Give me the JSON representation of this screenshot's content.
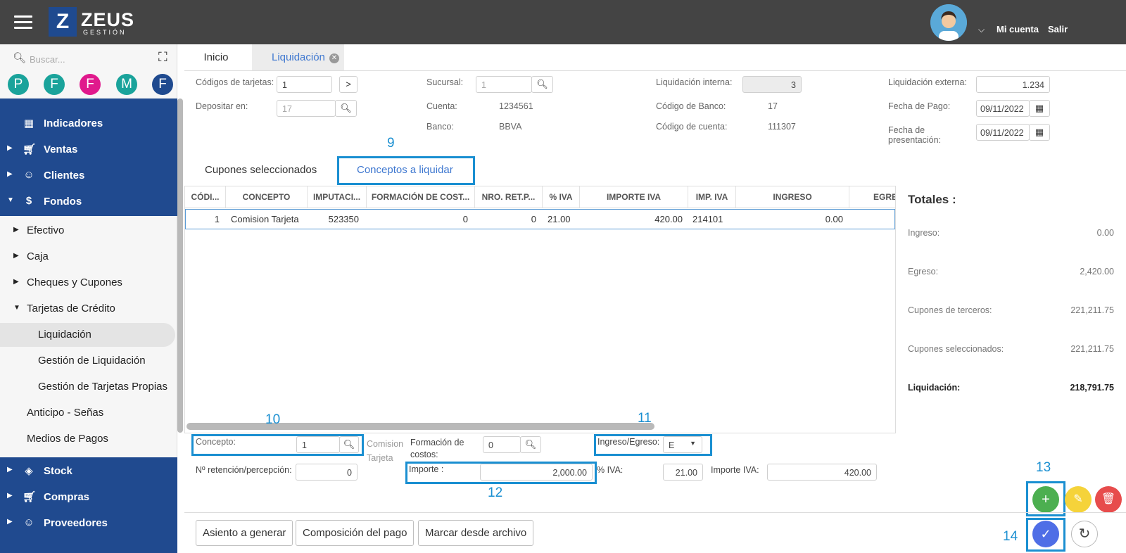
{
  "app": {
    "logo_letter": "Z",
    "logo_name": "ZEUS",
    "logo_sub": "GESTIÓN"
  },
  "header": {
    "account_label": "Mi cuenta",
    "logout_label": "Salir"
  },
  "sidebar": {
    "search_placeholder": "Buscar...",
    "favorites": [
      {
        "letter": "P",
        "color": "#1aa39b"
      },
      {
        "letter": "F",
        "color": "#1aa39b"
      },
      {
        "letter": "F",
        "color": "#e0198c"
      },
      {
        "letter": "M",
        "color": "#1aa39b"
      },
      {
        "letter": "F",
        "color": "#1f4a8f"
      }
    ],
    "top_items": [
      {
        "label": "Indicadores",
        "icon": "dashboard-icon"
      },
      {
        "label": "Ventas",
        "icon": "cart-icon"
      },
      {
        "label": "Clientes",
        "icon": "users-icon"
      },
      {
        "label": "Fondos",
        "icon": "dollar-icon"
      }
    ],
    "fondos_items": [
      {
        "label": "Efectivo"
      },
      {
        "label": "Caja"
      },
      {
        "label": "Cheques y Cupones"
      },
      {
        "label": "Tarjetas de Crédito"
      },
      {
        "label": "Liquidación"
      },
      {
        "label": "Gestión de Liquidación"
      },
      {
        "label": "Gestión de Tarjetas Propias"
      },
      {
        "label": "Anticipo - Señas"
      },
      {
        "label": "Medios de Pagos"
      }
    ],
    "bottom_items": [
      {
        "label": "Stock",
        "icon": "layers-icon"
      },
      {
        "label": "Compras",
        "icon": "cart-add-icon"
      },
      {
        "label": "Proveedores",
        "icon": "users-icon"
      }
    ]
  },
  "tabs": {
    "home": "Inicio",
    "active": "Liquidación"
  },
  "form": {
    "codigos_label": "Códigos de tarjetas:",
    "codigos_value": "1",
    "next_btn": ">",
    "depositar_label": "Depositar en:",
    "depositar_value": "17",
    "sucursal_label": "Sucursal:",
    "sucursal_value": "1",
    "cuenta_label": "Cuenta:",
    "cuenta_value": "1234561",
    "banco_label": "Banco:",
    "banco_value": "BBVA",
    "liq_interna_label": "Liquidación interna:",
    "liq_interna_value": "3",
    "cod_banco_label": "Código de Banco:",
    "cod_banco_value": "17",
    "cod_cuenta_label": "Código de cuenta:",
    "cod_cuenta_value": "111307",
    "liq_externa_label": "Liquidación externa:",
    "liq_externa_value": "1.234",
    "fecha_pago_label": "Fecha de Pago:",
    "fecha_pago_value": "09/11/2022",
    "fecha_pres_label1": "Fecha de",
    "fecha_pres_label2": "presentación:",
    "fecha_pres_value": "09/11/2022"
  },
  "subtabs": {
    "cupones": "Cupones seleccionados",
    "conceptos": "Conceptos a liquidar"
  },
  "callouts": {
    "c9": "9",
    "c10": "10",
    "c11": "11",
    "c12": "12",
    "c13": "13",
    "c14": "14"
  },
  "grid": {
    "columns": [
      "CÓDI...",
      "CONCEPTO",
      "IMPUTACI...",
      "FORMACIÓN DE COST...",
      "NRO. RET.P...",
      "% IVA",
      "IMPORTE IVA",
      "IMP. IVA",
      "INGRESO",
      "EGRE"
    ],
    "row": [
      "1",
      "Comision Tarjeta",
      "523350",
      "0",
      "0",
      "21.00",
      "420.00",
      "214101",
      "0.00",
      ""
    ]
  },
  "totals": {
    "title": "Totales :",
    "ingreso_label": "Ingreso:",
    "ingreso_value": "0.00",
    "egreso_label": "Egreso:",
    "egreso_value": "2,420.00",
    "terceros_label": "Cupones de terceros:",
    "terceros_value": "221,211.75",
    "seleccionados_label": "Cupones seleccionados:",
    "seleccionados_value": "221,211.75",
    "liquidacion_label": "Liquidación:",
    "liquidacion_value": "218,791.75"
  },
  "detail": {
    "concepto_label": "Concepto:",
    "concepto_value": "1",
    "concepto_desc1": "Comision",
    "concepto_desc2": "Tarjeta",
    "formacion_label1": "Formación de",
    "formacion_label2": "costos:",
    "formacion_value": "0",
    "ie_label": "Ingreso/Egreso:",
    "ie_value": "E",
    "retencion_label": "Nº retención/percepción:",
    "retencion_value": "0",
    "importe_label": "Importe :",
    "importe_value": "2,000.00",
    "iva_label": "% IVA:",
    "iva_value": "21.00",
    "importe_iva_label": "Importe IVA:",
    "importe_iva_value": "420.00"
  },
  "actions": {
    "add": "+",
    "edit": "✎",
    "delete": "🗑",
    "confirm": "✓",
    "refresh": "↻"
  },
  "footer": {
    "asiento": "Asiento a generar",
    "composicion": "Composición del pago",
    "marcar": "Marcar desde archivo"
  },
  "colors": {
    "topbar": "#444444",
    "nav": "#204a8f",
    "accent": "#3f78d0",
    "highlight": "#1a8fd1",
    "add": "#4caf50",
    "edit": "#f5d33a",
    "delete": "#e74c4c",
    "confirm": "#4f6ee6"
  }
}
